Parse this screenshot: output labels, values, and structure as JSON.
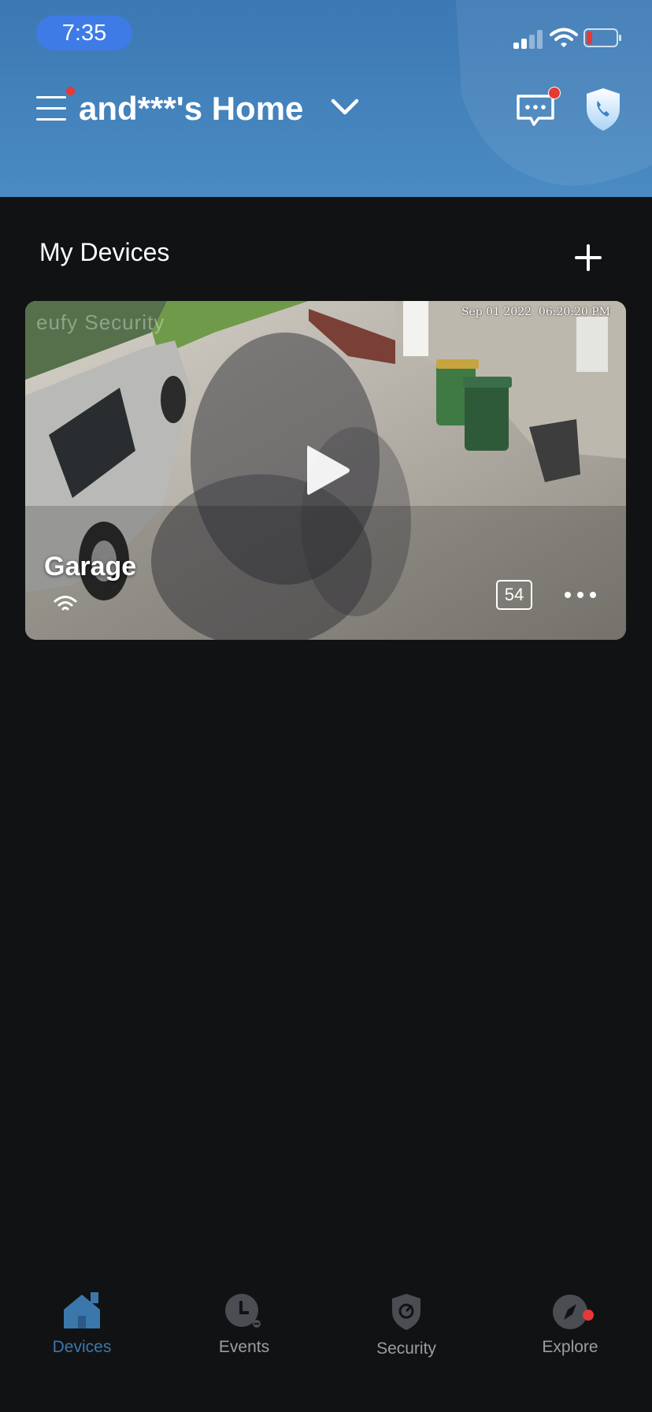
{
  "status_bar": {
    "time": "7:35"
  },
  "header": {
    "home_title": "and***'s Home",
    "colors": {
      "background": "#4a8bc3",
      "badge": "#e53935",
      "time_pill": "#3e7be6"
    },
    "icons": [
      "menu-icon",
      "chevron-down-icon",
      "message-icon",
      "security-call-shield-icon"
    ]
  },
  "main": {
    "section_title": "My Devices",
    "devices": [
      {
        "name": "Garage",
        "timestamp": "Sep 01 2022  06:20:20 PM",
        "watermark": "eufy Security",
        "battery": "54",
        "connection": "wifi"
      }
    ]
  },
  "tabbar": {
    "active_color": "#3b77ab",
    "tabs": [
      {
        "label": "Devices",
        "icon": "home-icon",
        "active": true
      },
      {
        "label": "Events",
        "icon": "clock-icon",
        "active": false
      },
      {
        "label": "Security",
        "icon": "shield-icon",
        "active": false
      },
      {
        "label": "Explore",
        "icon": "compass-icon",
        "active": false
      }
    ]
  }
}
